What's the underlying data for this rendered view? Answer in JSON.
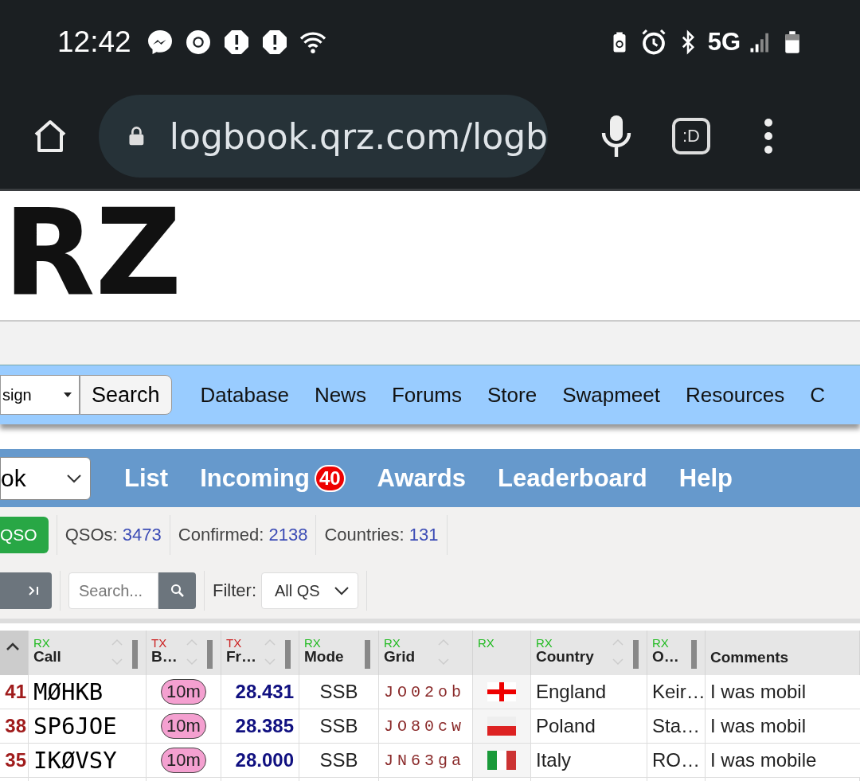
{
  "status_bar": {
    "time": "12:42",
    "network": "5G"
  },
  "browser": {
    "url": "logbook.qrz.com/logb",
    "tab_button": ":D"
  },
  "logo": {
    "text": "RZ"
  },
  "site_nav": {
    "lookup_select": "sign",
    "search_button": "Search",
    "links": [
      "Database",
      "News",
      "Forums",
      "Store",
      "Swapmeet",
      "Resources",
      "C"
    ]
  },
  "logbook_nav": {
    "book_select": "ok",
    "links": [
      {
        "label": "List"
      },
      {
        "label": "Incoming",
        "badge": "40"
      },
      {
        "label": "Awards"
      },
      {
        "label": "Leaderboard"
      },
      {
        "label": "Help"
      }
    ]
  },
  "stats": {
    "add_button": "QSO",
    "items": [
      {
        "label": "QSOs:",
        "value": "3473"
      },
      {
        "label": "Confirmed:",
        "value": "2138"
      },
      {
        "label": "Countries:",
        "value": "131"
      }
    ]
  },
  "controls": {
    "search_placeholder": "Search...",
    "filter_label": "Filter:",
    "filter_value": "All QS"
  },
  "table": {
    "columns": [
      {
        "kind": "index",
        "sorted": true,
        "resizable": false
      },
      {
        "kind": "text",
        "tag": "RX",
        "color": "#22bb22",
        "label": "Call",
        "sortable": true,
        "sorted": false,
        "resizable": true
      },
      {
        "kind": "text",
        "tag": "TX",
        "color": "#cc2222",
        "label": "B…",
        "sortable": true,
        "sorted": false,
        "resizable": true
      },
      {
        "kind": "text",
        "tag": "TX",
        "color": "#cc2222",
        "label": "Fr…",
        "sortable": true,
        "sorted": false,
        "resizable": true
      },
      {
        "kind": "text",
        "tag": "RX",
        "color": "#22bb22",
        "label": "Mode",
        "sortable": false,
        "sorted": false,
        "resizable": true
      },
      {
        "kind": "text",
        "tag": "RX",
        "color": "#22bb22",
        "label": "Grid",
        "sortable": true,
        "sorted": false,
        "resizable": false
      },
      {
        "kind": "text",
        "tag": "RX",
        "color": "#22bb22",
        "sortable": false,
        "sorted": false,
        "resizable": false
      },
      {
        "kind": "text",
        "tag": "RX",
        "color": "#22bb22",
        "label": "Country",
        "sortable": true,
        "sorted": false,
        "resizable": true
      },
      {
        "kind": "text",
        "tag": "RX",
        "color": "#22bb22",
        "label": "O…",
        "sortable": false,
        "sorted": false,
        "resizable": true
      },
      {
        "kind": "text",
        "label": "Comments",
        "sortable": false,
        "sorted": false,
        "resizable": false
      }
    ],
    "rows": [
      {
        "index": "41",
        "call": "MØHKB",
        "band": "10m",
        "freq": "28.431",
        "mode": "SSB",
        "grid": "JO02ob",
        "flag": {
          "kind": "england"
        },
        "country": "England",
        "op": "Keir…",
        "comments": "I was mobil"
      },
      {
        "index": "38",
        "call": "SP6JOE",
        "band": "10m",
        "freq": "28.385",
        "mode": "SSB",
        "grid": "JO80cw",
        "flag": {
          "kind": "poland"
        },
        "country": "Poland",
        "op": "Sta…",
        "comments": "I was mobil"
      },
      {
        "index": "35",
        "call": "IKØVSY",
        "band": "10m",
        "freq": "28.000",
        "mode": "SSB",
        "grid": "JN63ga",
        "flag": {
          "kind": "italy"
        },
        "country": "Italy",
        "op": "RO…",
        "comments": "I was mobile"
      }
    ]
  }
}
